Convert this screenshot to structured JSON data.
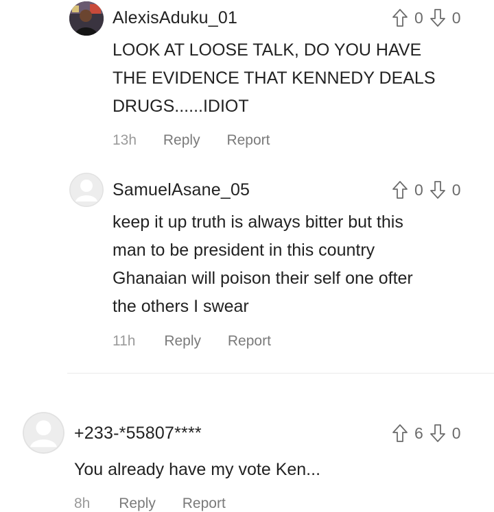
{
  "comments": [
    {
      "username": "AlexisAduku_01",
      "text": "LOOK AT LOOSE TALK, DO YOU HAVE\nTHE EVIDENCE THAT KENNEDY DEALS\nDRUGS......IDIOT",
      "upvotes": "0",
      "downvotes": "0",
      "time": "13h",
      "reply_label": "Reply",
      "report_label": "Report",
      "avatar": "user-photo"
    },
    {
      "username": "SamuelAsane_05",
      "text": "keep it up truth is always bitter but  this\nman to be president in this country\nGhanaian will poison  their self one ofter\nthe others I swear",
      "upvotes": "0",
      "downvotes": "0",
      "time": "11h",
      "reply_label": "Reply",
      "report_label": "Report",
      "avatar": "default-user-icon"
    },
    {
      "username": "+233-*55807****",
      "text": "You already have my vote Ken...",
      "upvotes": "6",
      "downvotes": "0",
      "time": "8h",
      "reply_label": "Reply",
      "report_label": "Report",
      "avatar": "default-user-icon"
    }
  ],
  "colors": {
    "text": "#222222",
    "secondary": "#7a7a7a",
    "icon": "#6b6b6b",
    "divider": "#e9e9e9"
  }
}
